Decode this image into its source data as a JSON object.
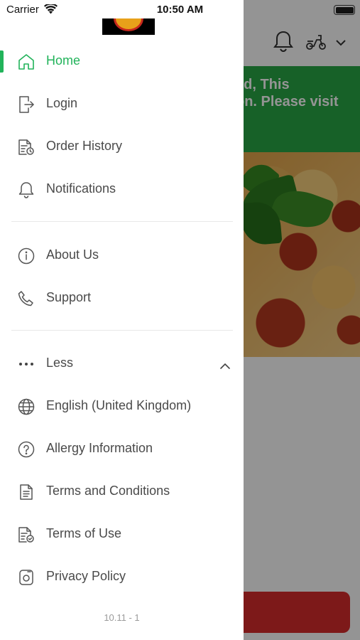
{
  "status_bar": {
    "carrier": "Carrier",
    "time": "10:50 AM"
  },
  "background": {
    "banner_text": "ed, This\non. Please visit\n"
  },
  "drawer": {
    "menu_primary": [
      {
        "label": "Home",
        "icon": "home-icon",
        "active": true
      },
      {
        "label": "Login",
        "icon": "login-icon"
      },
      {
        "label": "Order History",
        "icon": "order-history-icon"
      },
      {
        "label": "Notifications",
        "icon": "bell-icon"
      }
    ],
    "menu_secondary": [
      {
        "label": "About Us",
        "icon": "info-icon"
      },
      {
        "label": "Support",
        "icon": "phone-icon"
      }
    ],
    "less_toggle": {
      "label": "Less",
      "icon": "more-dots-icon"
    },
    "menu_more": [
      {
        "label": "English (United Kingdom)",
        "icon": "globe-icon"
      },
      {
        "label": "Allergy Information",
        "icon": "question-icon"
      },
      {
        "label": "Terms and Conditions",
        "icon": "document-icon"
      },
      {
        "label": "Terms of Use",
        "icon": "document-check-icon"
      },
      {
        "label": "Privacy Policy",
        "icon": "privacy-icon"
      }
    ],
    "version": "10.11 - 1"
  },
  "colors": {
    "accent": "#21b35a",
    "banner": "#28a745",
    "cta": "#d82c2c",
    "text": "#4a4a4a"
  }
}
